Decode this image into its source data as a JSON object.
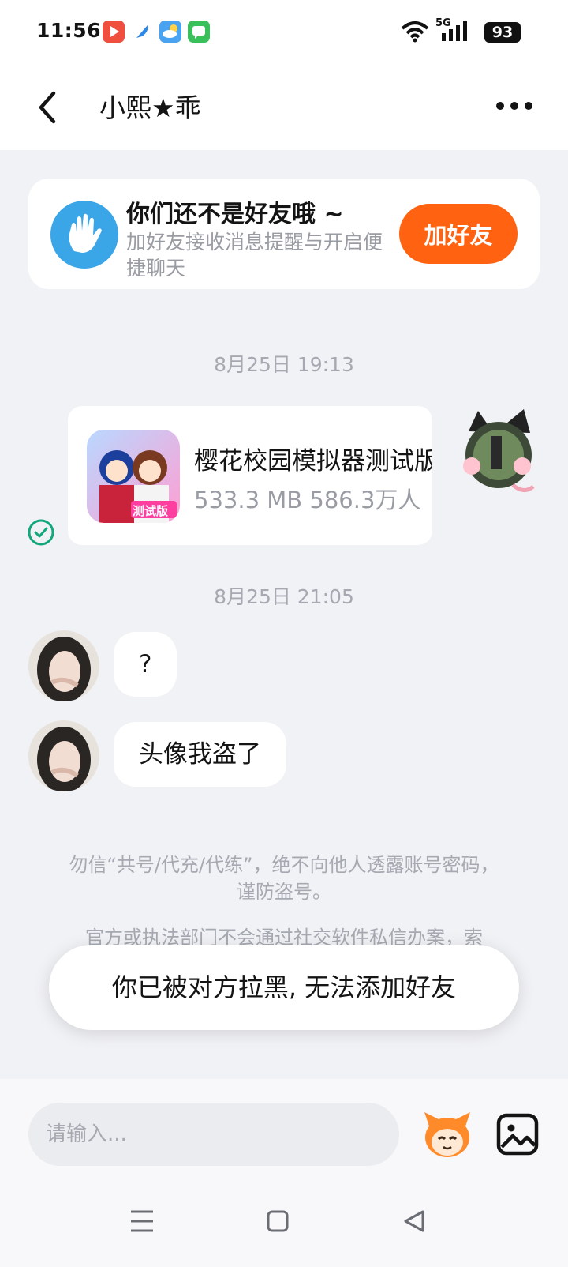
{
  "status_bar": {
    "time": "11:56",
    "signal_label": "5G",
    "battery": "93"
  },
  "header": {
    "title": "小熙★乖"
  },
  "friend_prompt": {
    "title": "你们还不是好友哦 ~",
    "subtitle": "加好友接收消息提醒与开启便捷聊天",
    "button": "加好友"
  },
  "messages": [
    {
      "timestamp": "8月25日 19:13"
    },
    {
      "app_card": {
        "name": "樱花校园模拟器测试版",
        "meta": "533.3 MB  586.3万人",
        "badge": "测试版"
      }
    },
    {
      "timestamp": "8月25日 21:05"
    },
    {
      "text": "?"
    },
    {
      "text": "头像我盗了"
    }
  ],
  "notice": {
    "line1": "勿信“共号/代充/代练”，绝不向他人透露账号密码，谨防盗号。",
    "line2": "官方或执法部门不会通过社交软件私信办案，索"
  },
  "toast": "你已被对方拉黑, 无法添加好友",
  "input": {
    "placeholder": "请输入..."
  },
  "colors": {
    "accent": "#ff6210",
    "check": "#14a77d",
    "hand_icon": "#3aa6e8"
  }
}
